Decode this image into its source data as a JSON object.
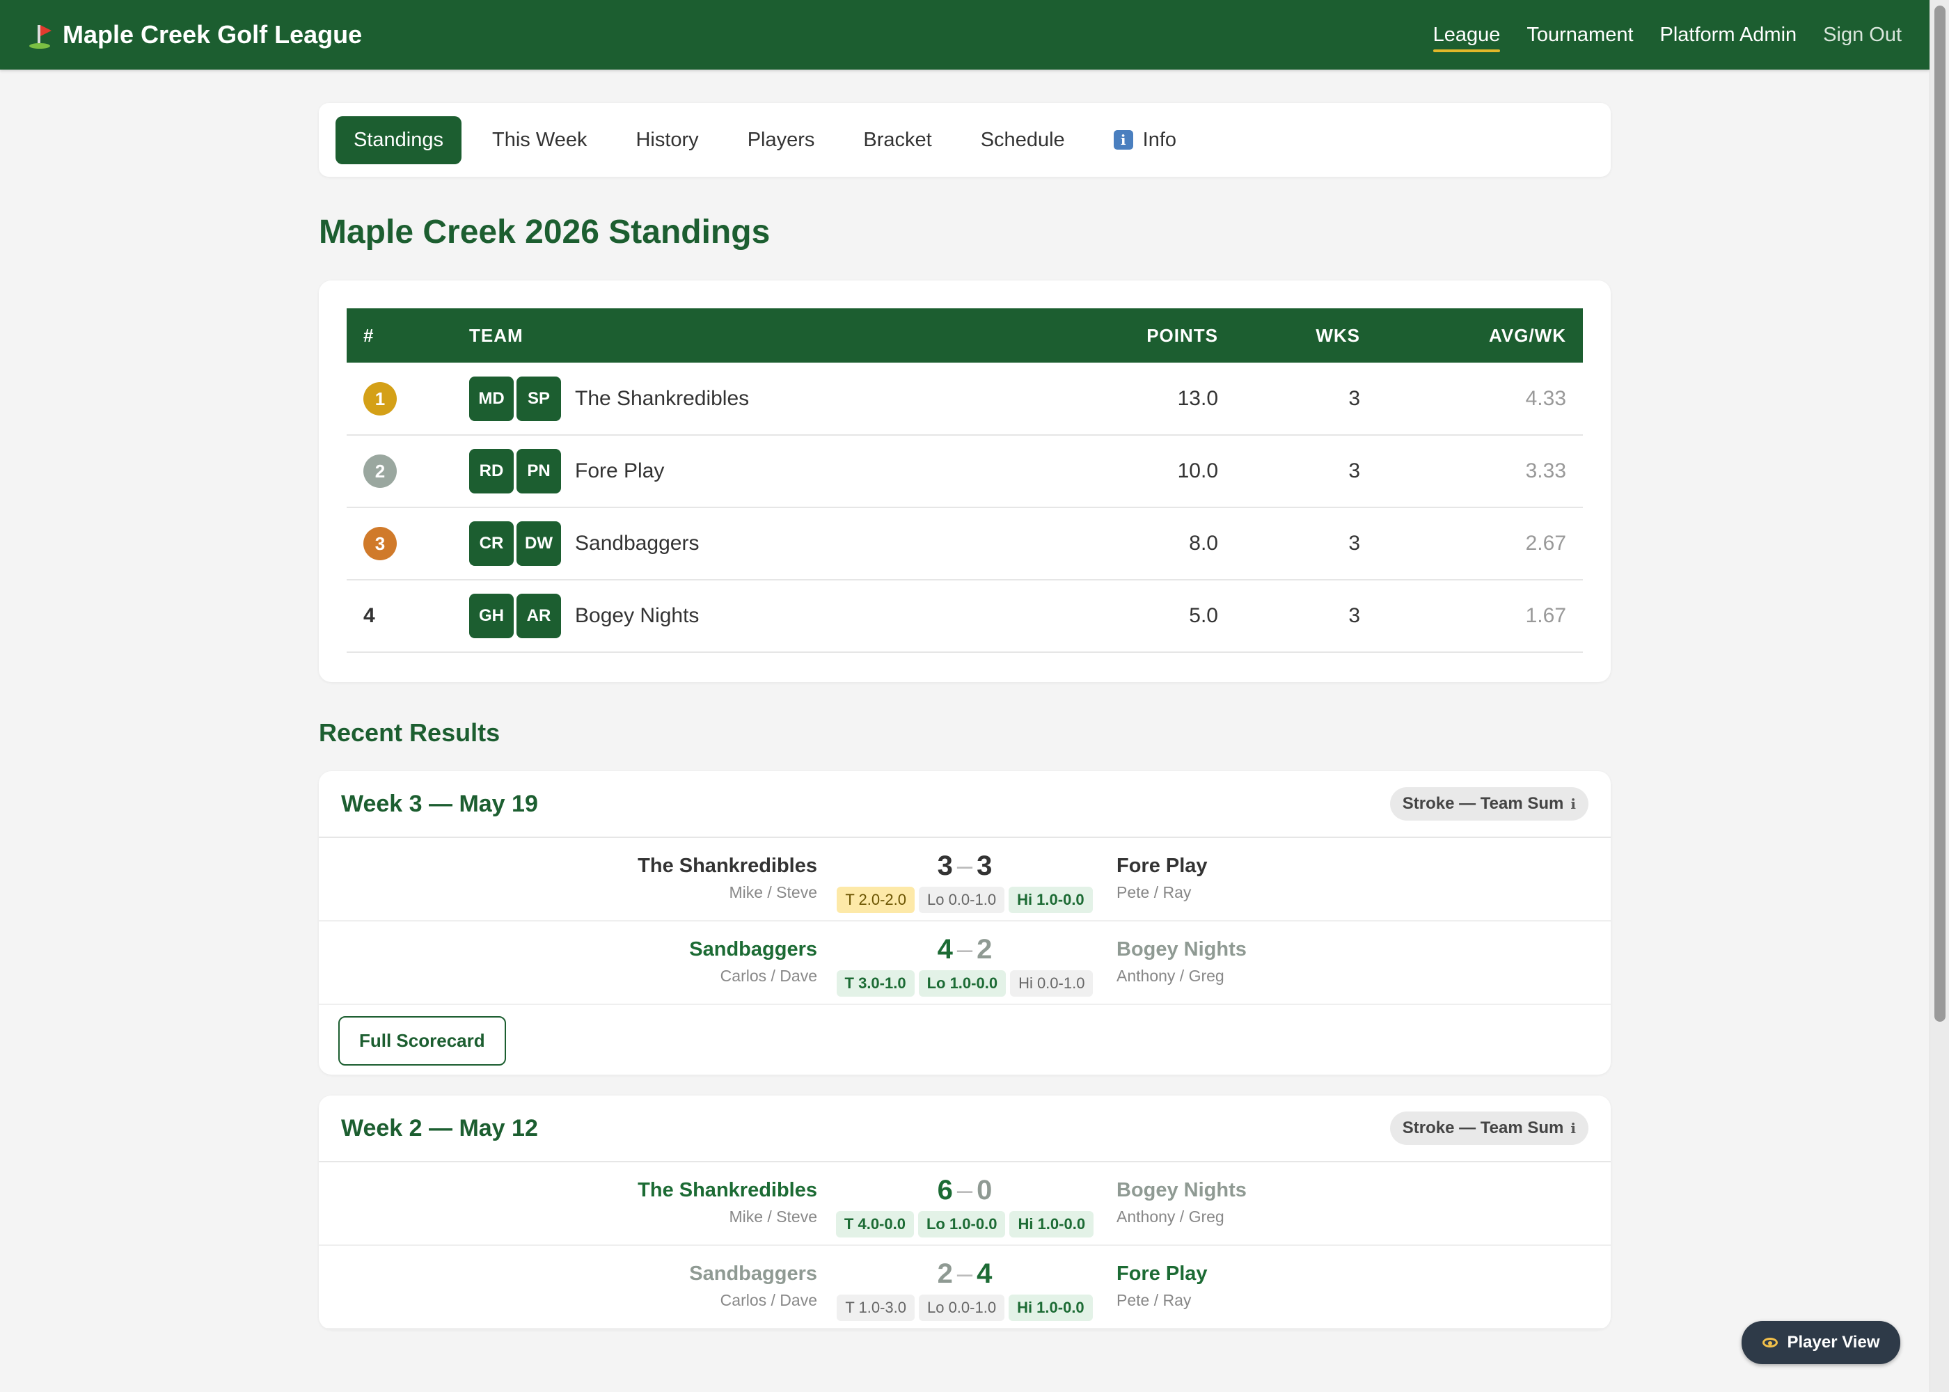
{
  "header": {
    "title": "Maple Creek Golf League",
    "nav": [
      "League",
      "Tournament",
      "Platform Admin",
      "Sign Out"
    ]
  },
  "tabs": [
    "Standings",
    "This Week",
    "History",
    "Players",
    "Bracket",
    "Schedule",
    "Info"
  ],
  "page_title": "Maple Creek 2026 Standings",
  "standings": {
    "headers": [
      "#",
      "TEAM",
      "POINTS",
      "WKS",
      "AVG/WK"
    ],
    "rows": [
      {
        "rank": "1",
        "initials": [
          "MD",
          "SP"
        ],
        "team": "The Shankredibles",
        "points": "13.0",
        "wks": "3",
        "avg": "4.33"
      },
      {
        "rank": "2",
        "initials": [
          "RD",
          "PN"
        ],
        "team": "Fore Play",
        "points": "10.0",
        "wks": "3",
        "avg": "3.33"
      },
      {
        "rank": "3",
        "initials": [
          "CR",
          "DW"
        ],
        "team": "Sandbaggers",
        "points": "8.0",
        "wks": "3",
        "avg": "2.67"
      },
      {
        "rank": "4",
        "initials": [
          "GH",
          "AR"
        ],
        "team": "Bogey Nights",
        "points": "5.0",
        "wks": "3",
        "avg": "1.67"
      }
    ]
  },
  "recent_results": {
    "title": "Recent Results",
    "weeks": [
      {
        "title": "Week 3 — May 19",
        "format": "Stroke — Team Sum",
        "matches": [
          {
            "left_team": "The Shankredibles",
            "left_players": "Mike / Steve",
            "left_score": "3",
            "right_score": "3",
            "right_team": "Fore Play",
            "right_players": "Pete / Ray",
            "chips": [
              "T 2.0-2.0",
              "Lo 0.0-1.0",
              "Hi 1.0-0.0"
            ]
          },
          {
            "left_team": "Sandbaggers",
            "left_players": "Carlos / Dave",
            "left_score": "4",
            "right_score": "2",
            "right_team": "Bogey Nights",
            "right_players": "Anthony / Greg",
            "chips": [
              "T 3.0-1.0",
              "Lo 1.0-0.0",
              "Hi 0.0-1.0"
            ]
          }
        ],
        "button": "Full Scorecard"
      },
      {
        "title": "Week 2 — May 12",
        "format": "Stroke — Team Sum",
        "matches": [
          {
            "left_team": "The Shankredibles",
            "left_players": "Mike / Steve",
            "left_score": "6",
            "right_score": "0",
            "right_team": "Bogey Nights",
            "right_players": "Anthony / Greg",
            "chips": [
              "T 4.0-0.0",
              "Lo 1.0-0.0",
              "Hi 1.0-0.0"
            ]
          },
          {
            "left_team": "Sandbaggers",
            "left_players": "Carlos / Dave",
            "left_score": "2",
            "right_score": "4",
            "right_team": "Fore Play",
            "right_players": "Pete / Ray",
            "chips": [
              "T 1.0-3.0",
              "Lo 0.0-1.0",
              "Hi 1.0-0.0"
            ]
          }
        ]
      }
    ]
  },
  "floating_button": "Player View",
  "colors": {
    "primary": "#1c5e30",
    "gold": "#d4a017",
    "silver": "#9aa79f",
    "bronze": "#d07a2a",
    "tie": "#fde9a8"
  }
}
